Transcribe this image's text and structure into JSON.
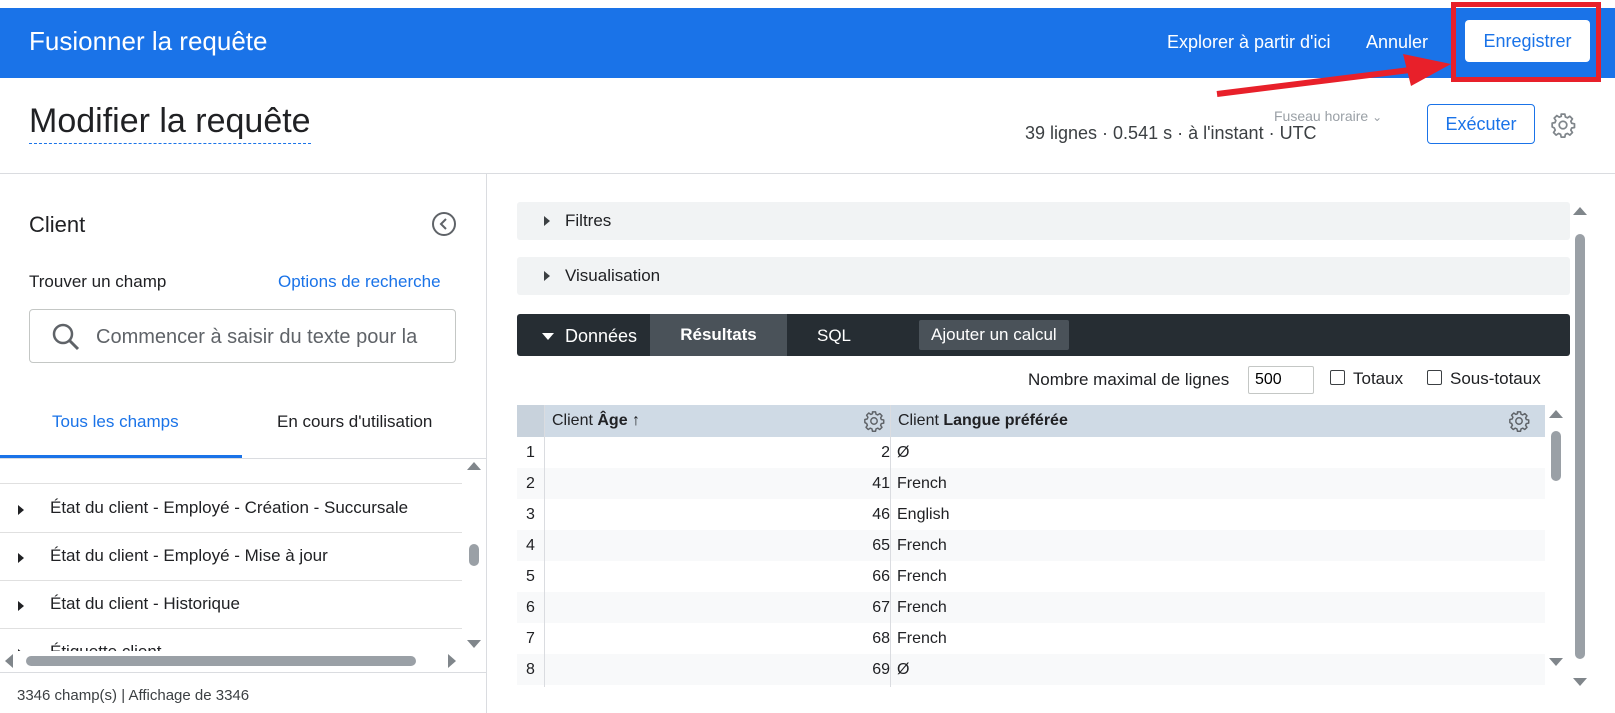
{
  "topbar": {
    "title": "Fusionner la requête",
    "explore_link": "Explorer à partir d'ici",
    "cancel_label": "Annuler",
    "save_label": "Enregistrer",
    "bg_color": "#1a73e8",
    "highlight_color": "#e8202a"
  },
  "header": {
    "title": "Modifier la requête",
    "timezone_label": "Fuseau horaire",
    "stats": "39 lignes · 0.541 s · à l'instant · UTC",
    "run_label": "Exécuter"
  },
  "sidebar": {
    "explore_name": "Client",
    "find_field_label": "Trouver un champ",
    "search_options": "Options de recherche",
    "search_placeholder": "Commencer à saisir du texte pour la",
    "tabs": [
      "Tous les champs",
      "En cours d'utilisation"
    ],
    "fields": [
      "État du client - Employé - Création - Succursale",
      "État du client - Employé - Mise à jour",
      "État du client - Historique",
      "Étiquette client"
    ],
    "field_count": "3346 champ(s) | Affichage de 3346"
  },
  "sections": {
    "filters": "Filtres",
    "visualization": "Visualisation",
    "data": "Données",
    "tabs": {
      "results": "Résultats",
      "sql": "SQL"
    },
    "add_calc": "Ajouter un calcul"
  },
  "options": {
    "row_limit_label": "Nombre maximal de lignes",
    "row_limit_value": "500",
    "totals_label": "Totaux",
    "subtotals_label": "Sous-totaux"
  },
  "table": {
    "columns": [
      {
        "prefix": "Client",
        "name": "Âge ↑"
      },
      {
        "prefix": "Client",
        "name": "Langue préférée"
      }
    ],
    "rows": [
      {
        "n": "1",
        "age": "2",
        "lang": "Ø"
      },
      {
        "n": "2",
        "age": "41",
        "lang": "French"
      },
      {
        "n": "3",
        "age": "46",
        "lang": "English"
      },
      {
        "n": "4",
        "age": "65",
        "lang": "French"
      },
      {
        "n": "5",
        "age": "66",
        "lang": "French"
      },
      {
        "n": "6",
        "age": "67",
        "lang": "French"
      },
      {
        "n": "7",
        "age": "68",
        "lang": "French"
      },
      {
        "n": "8",
        "age": "69",
        "lang": "Ø"
      }
    ]
  }
}
